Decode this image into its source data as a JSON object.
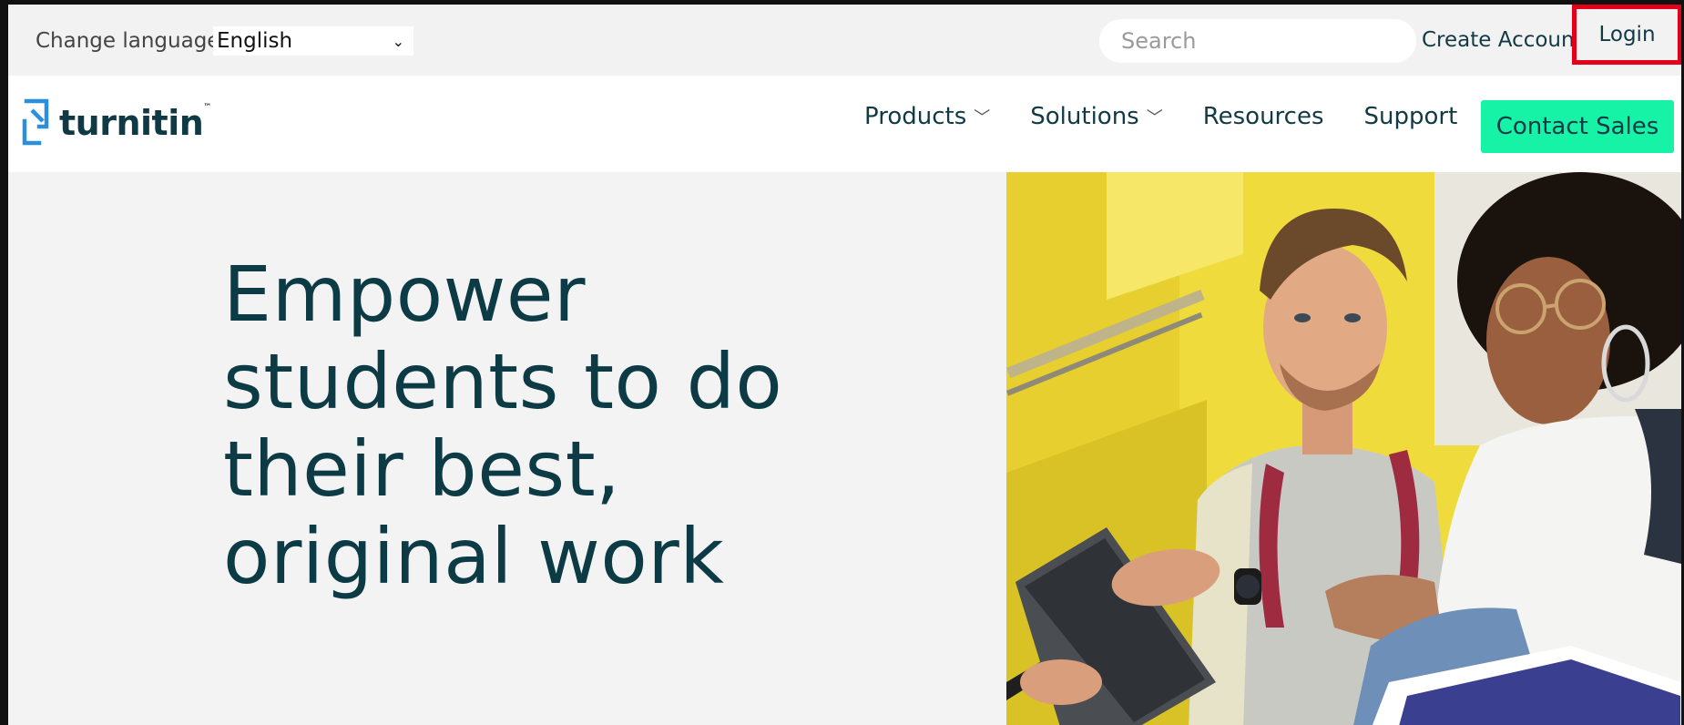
{
  "utility_bar": {
    "language_label": "Change language",
    "language_selected": "English",
    "search_placeholder": "Search",
    "create_account": "Create Account",
    "login": "Login"
  },
  "main_nav": {
    "logo_text": "turnitin",
    "logo_tm": "™",
    "items": [
      {
        "label": "Products",
        "has_dropdown": true
      },
      {
        "label": "Solutions",
        "has_dropdown": true
      },
      {
        "label": "Resources",
        "has_dropdown": false
      },
      {
        "label": "Support",
        "has_dropdown": false
      }
    ],
    "contact_sales": "Contact Sales"
  },
  "hero": {
    "title_lines": [
      "Empower",
      "students to do",
      "their best,",
      "original work"
    ]
  },
  "colors": {
    "accent_button": "#16f2a6",
    "brand_dark": "#0d3b45",
    "logo_blue": "#2b8fe0",
    "highlight_box": "#e3001b"
  }
}
